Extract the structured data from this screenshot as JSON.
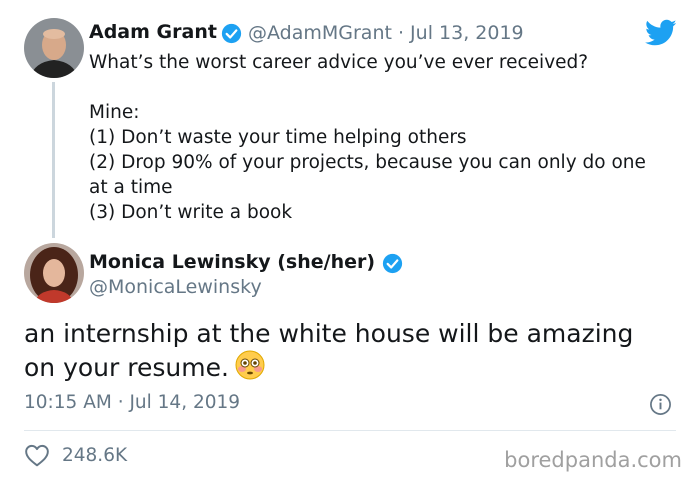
{
  "original_tweet": {
    "author_name": "Adam Grant",
    "handle_date": "@AdamMGrant · Jul 13, 2019",
    "text_lines": [
      "What’s the worst career advice you’ve ever received?",
      "",
      "Mine:",
      "(1) Don’t waste your time helping others",
      "(2) Drop 90% of your projects, because you can only do one",
      "at a time",
      "(3) Don’t write a book"
    ]
  },
  "reply_tweet": {
    "author_name": "Monica Lewinsky (she/her)",
    "handle": "@MonicaLewinsky",
    "text_lines": [
      "an internship at the white house will be amazing",
      "on your resume."
    ],
    "emoji": "flushed-face",
    "timestamp": "10:15 AM · Jul 14, 2019",
    "likes": "248.6K"
  },
  "watermark": "boredpanda.com",
  "colors": {
    "verified": "#1da1f2",
    "twitter_brand": "#1da1f2",
    "secondary_text": "#657786"
  }
}
